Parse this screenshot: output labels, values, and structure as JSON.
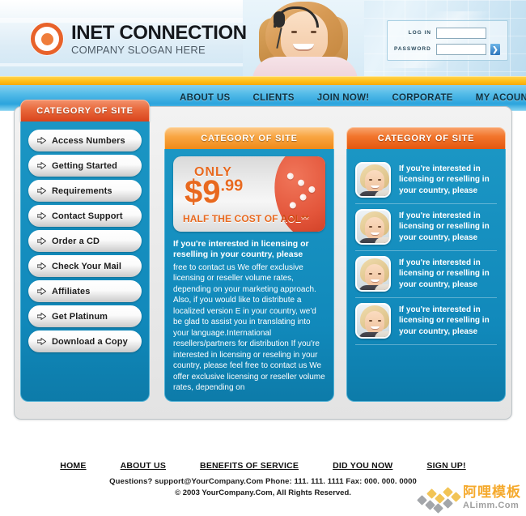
{
  "brand": {
    "logo_icon": "target-circle-icon",
    "title": "INET CONNECTION",
    "slogan": "COMPANY SLOGAN HERE",
    "accent_orange": "#e8622a",
    "accent_blue": "#1189bb",
    "accent_yellow": "#ffbe16"
  },
  "login": {
    "username_label": "LOG IN",
    "password_label": "PASSWORD",
    "username_value": "",
    "password_value": "",
    "username_placeholder": "",
    "password_placeholder": "",
    "submit_icon": "chevron-right-icon"
  },
  "nav": {
    "items": [
      {
        "label": "ABOUT US"
      },
      {
        "label": "CLIENTS"
      },
      {
        "label": "JOIN NOW!"
      },
      {
        "label": "CORPORATE"
      },
      {
        "label": "MY ACOUNT"
      }
    ]
  },
  "sidebar": {
    "heading": "CATEGORY OF SITE",
    "items": [
      {
        "label": "Access Numbers",
        "icon": "arrow-right-icon"
      },
      {
        "label": "Getting Started",
        "icon": "arrow-right-icon"
      },
      {
        "label": "Requirements",
        "icon": "arrow-right-icon"
      },
      {
        "label": "Contact Support",
        "icon": "arrow-right-icon"
      },
      {
        "label": "Order a CD",
        "icon": "arrow-right-icon"
      },
      {
        "label": "Check Your Mail",
        "icon": "arrow-right-icon"
      },
      {
        "label": "Affiliates",
        "icon": "arrow-right-icon"
      },
      {
        "label": "Get Platinum",
        "icon": "arrow-right-icon"
      },
      {
        "label": "Download a Copy",
        "icon": "arrow-right-icon"
      }
    ]
  },
  "center_panel": {
    "heading": "CATEGORY OF SITE",
    "promo": {
      "kicker": "ONLY",
      "price_currency": "$",
      "price_whole": "9",
      "price_cents": ".99",
      "tagline_prefix": "HALF THE COST OF ",
      "tagline_brand": "AOL**"
    },
    "lead": "If you're interested in licensing or reselling  in your country, please",
    "body": " free to contact us We offer exclusive licensing or reseller volume rates, depending on your marketing approach. Also, if you would like to distribute a localized version E in your country, we'd be glad to assist you in translating  into your language.International resellers/partners for distribution If you're interested in licensing or reseling in your country, please feel free to contact us We offer exclusive licensing or reseller volume rates, depending on"
  },
  "right_panel": {
    "heading": "CATEGORY OF SITE",
    "items": [
      {
        "avatar": "woman-portrait-avatar",
        "text": "If you're interested in licensing or reselling  in your country, please"
      },
      {
        "avatar": "woman-portrait-avatar",
        "text": "If you're interested in licensing or reselling  in your country, please"
      },
      {
        "avatar": "woman-portrait-avatar",
        "text": "If you're interested in licensing or reselling  in your country, please"
      },
      {
        "avatar": "woman-portrait-avatar",
        "text": "If you're interested in licensing or reselling  in your country, please"
      }
    ]
  },
  "hero": {
    "image_name": "call-center-woman-with-headset"
  },
  "footer": {
    "links": [
      {
        "label": "HOME"
      },
      {
        "label": "ABOUT US"
      },
      {
        "label": "BENEFITS OF SERVICE"
      },
      {
        "label": "DID YOU NOW"
      },
      {
        "label": "SIGN UP!"
      }
    ],
    "contact_line": "Questions? support@YourCompany.Com Phone: 111. 111. 1111  Fax: 000. 000. 0000",
    "copyright_line": "© 2003 YourCompany.Com, All Rights Reserved."
  },
  "watermark": {
    "cn_text": "阿哩模板",
    "en_text": "ALimm.Com"
  }
}
